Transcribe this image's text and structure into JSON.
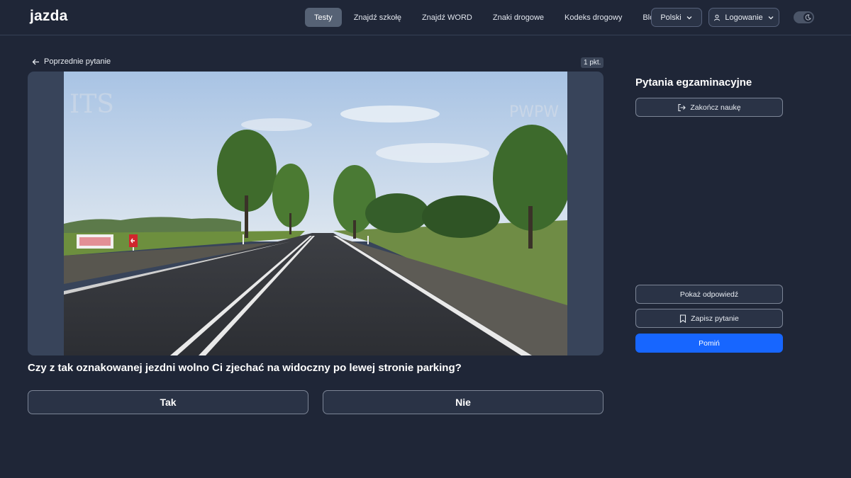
{
  "header": {
    "logo": "jazda",
    "nav": [
      {
        "label": "Testy",
        "active": true
      },
      {
        "label": "Znajdź szkołę",
        "active": false
      },
      {
        "label": "Znajdź WORD",
        "active": false
      },
      {
        "label": "Znaki drogowe",
        "active": false
      },
      {
        "label": "Kodeks drogowy",
        "active": false
      },
      {
        "label": "Blog",
        "active": false
      }
    ],
    "language": "Polski",
    "login": "Logowanie"
  },
  "question_panel": {
    "previous": "Poprzednie pytanie",
    "points": "1 pkt.",
    "watermark_left": "ITS",
    "watermark_right": "PWPW",
    "question": "Czy z tak oznakowanej jezdni wolno Ci zjechać na widoczny po lewej stronie parking?",
    "answers": [
      "Tak",
      "Nie"
    ]
  },
  "sidebar": {
    "title": "Pytania egzaminacyjne",
    "end_learning": "Zakończ naukę",
    "show_answer": "Pokaż odpowiedź",
    "save_question": "Zapisz pytanie",
    "skip": "Pomiń"
  },
  "colors": {
    "background": "#1f2637",
    "accent": "#1766ff",
    "active_nav": "#566275"
  },
  "icons": [
    "arrow-left-icon",
    "chevron-down-icon",
    "user-icon",
    "moon-icon",
    "logout-icon",
    "bookmark-icon"
  ]
}
